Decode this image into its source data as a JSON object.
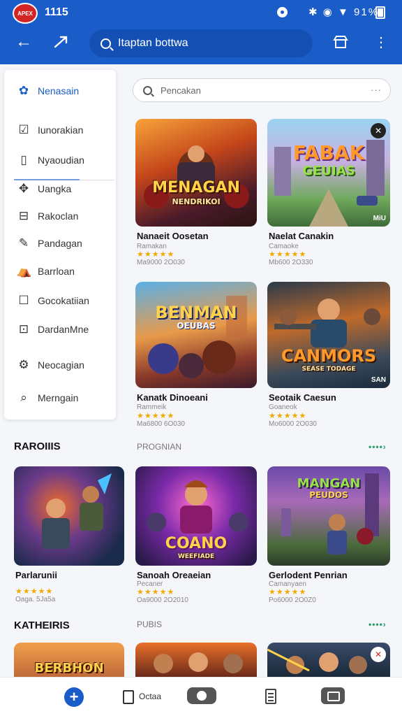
{
  "status_bar": {
    "time": "1115",
    "battery": "91%",
    "logo_text": "APEX"
  },
  "app_bar": {
    "search_value": "Itaptan bottwa"
  },
  "drawer": {
    "items": [
      {
        "label": "Nenasain",
        "icon": "gear-flower-icon",
        "active": true
      },
      {
        "label": "Iunorakian",
        "icon": "shield-check-icon"
      },
      {
        "label": "Nyaoudian",
        "icon": "door-icon"
      },
      {
        "label": "Uangka",
        "icon": "puzzle-icon"
      },
      {
        "label": "Rakoclan",
        "icon": "minus-box-icon"
      },
      {
        "label": "Pandagan",
        "icon": "pen-icon"
      },
      {
        "label": "Barrloan",
        "icon": "tent-icon"
      },
      {
        "label": "Gocokatiian",
        "icon": "square-icon"
      },
      {
        "label": "DardanMne",
        "icon": "chat-box-icon"
      },
      {
        "label": "Neocagian",
        "icon": "gear-icon"
      },
      {
        "label": "Merngain",
        "icon": "search-icon"
      }
    ]
  },
  "search": {
    "placeholder": "Pencakan"
  },
  "top_cards": [
    {
      "title": "Nanaeit Oosetan",
      "subtitle": "Ramakan",
      "stars": "★★★★★",
      "meta": "Ma9000 2O030",
      "thumb_text": "MENAGAN",
      "thumb_sub": "NENDRIKOI"
    },
    {
      "title": "Naelat Canakin",
      "subtitle": "Camaoke",
      "stars": "★★★★★",
      "meta": "Mb600 2O330",
      "thumb_text": "FABAK",
      "thumb_sub": "GEUIAS",
      "tag": "MiU"
    },
    {
      "title": "Kanatk Dinoeani",
      "subtitle": "Rammeik",
      "stars": "★★★★★",
      "meta": "Ma6800 6O030",
      "thumb_text": "BENMAN",
      "thumb_sub": "OEUBAS"
    },
    {
      "title": "Seotaik Caesun",
      "subtitle": "Goaneok",
      "stars": "★★★★★",
      "meta": "Mo6000 2O030",
      "thumb_text": "CANMORS",
      "thumb_sub": "SEASE TODAGE",
      "tag": "SAN"
    }
  ],
  "sections": [
    {
      "title": "RAROIIIS",
      "subtitle": "PROGNIAN",
      "more": "••••›",
      "cards": [
        {
          "title": "Parlarunii",
          "subtitle": "",
          "stars": "★★★★★",
          "meta": "Oaga. 5Ja5a"
        },
        {
          "title": "Sanoah Oreaeian",
          "subtitle": "Pecaner",
          "stars": "★★★★★",
          "meta": "Oa9000 2O2010",
          "thumb_text": "COANO",
          "thumb_sub": "WEEFIADE"
        },
        {
          "title": "Gerlodent Penrian",
          "subtitle": "Camanyaen",
          "stars": "★★★★★",
          "meta": "Po6000 2O0Z0",
          "thumb_text": "MANGAN",
          "thumb_sub": "PEUDOS"
        }
      ]
    },
    {
      "title": "KATHEIRIS",
      "subtitle": "PUBIS",
      "more": "••••›",
      "cards": [
        {
          "thumb_text": "BERBHON"
        },
        {},
        {}
      ]
    }
  ],
  "bottom_nav": {
    "doc_label": "Octaa"
  },
  "colors": {
    "primary": "#1a5cc8",
    "star": "#f2a900",
    "accent_green": "#2a9d6a"
  }
}
